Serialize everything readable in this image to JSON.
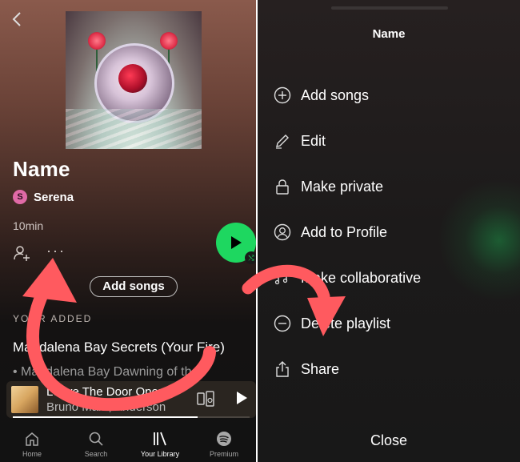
{
  "left": {
    "back_icon": "chevron-left-icon",
    "playlist_title": "Name",
    "owner": {
      "initial": "S",
      "name": "Serena"
    },
    "duration": "10min",
    "add_songs_label": "Add songs",
    "section_label": "YOUR ADDED",
    "track_title": "Magdalena Bay Secrets (Your Fire)",
    "track_sub": "• Magdalena Bay Dawning of the",
    "now_playing": {
      "title": "Leave The Door Open",
      "artist": "Bruno Mars, Anderson",
      "progress": 0.78
    },
    "nav": [
      {
        "label": "Home",
        "icon": "home-icon"
      },
      {
        "label": "Search",
        "icon": "search-icon"
      },
      {
        "label": "Your Library",
        "icon": "library-icon",
        "active": true
      },
      {
        "label": "Premium",
        "icon": "spotify-icon"
      }
    ],
    "colors": {
      "accent": "#1ed760",
      "avatar": "#e06aa6"
    }
  },
  "right": {
    "title": "Name",
    "menu": [
      {
        "label": "Add songs",
        "icon": "plus-circle-icon"
      },
      {
        "label": "Edit",
        "icon": "pencil-icon"
      },
      {
        "label": "Make private",
        "icon": "lock-icon"
      },
      {
        "label": "Add to Profile",
        "icon": "profile-icon"
      },
      {
        "label": "Make collaborative",
        "icon": "music-note-icon"
      },
      {
        "label": "Delete playlist",
        "icon": "minus-circle-icon"
      },
      {
        "label": "Share",
        "icon": "share-icon"
      }
    ],
    "close_label": "Close"
  },
  "annotation_color": "#ff5a5f"
}
